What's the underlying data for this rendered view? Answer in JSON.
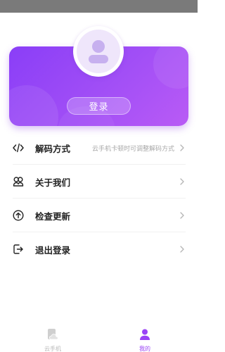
{
  "profile": {
    "login_label": "登录"
  },
  "menu": [
    {
      "label": "解码方式",
      "hint": "云手机卡顿时可调整解码方式",
      "icon": "code-icon"
    },
    {
      "label": "关于我们",
      "hint": "",
      "icon": "people-icon"
    },
    {
      "label": "检查更新",
      "hint": "",
      "icon": "update-icon"
    },
    {
      "label": "退出登录",
      "hint": "",
      "icon": "logout-icon"
    }
  ],
  "tabs": [
    {
      "label": "云手机",
      "icon": "cloud-phone-icon",
      "active": false,
      "color": "#c9c9c9"
    },
    {
      "label": "我的",
      "icon": "user-icon",
      "active": true,
      "color": "#9a43f6"
    }
  ],
  "colors": {
    "accent": "#9a43f6",
    "card_gradient_start": "#8a3ef7",
    "card_gradient_end": "#b95bf5"
  }
}
